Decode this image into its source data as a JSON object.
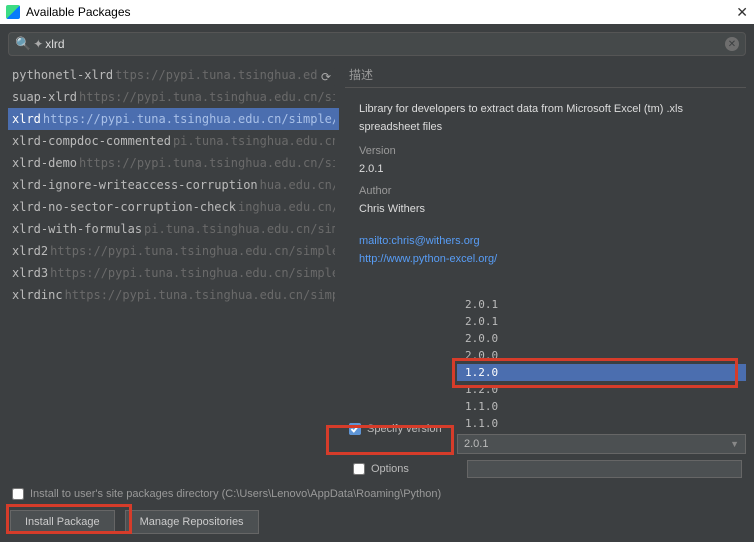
{
  "window": {
    "title": "Available Packages"
  },
  "search": {
    "value": "xlrd"
  },
  "packages": [
    {
      "name": "pythonetl-xlrd",
      "url": "ttps://pypi.tuna.tsinghua.edu.cn/simple/",
      "selected": false
    },
    {
      "name": "suap-xlrd",
      "url": "https://pypi.tuna.tsinghua.edu.cn/simple/",
      "selected": false
    },
    {
      "name": "xlrd",
      "url": "https://pypi.tuna.tsinghua.edu.cn/simple/",
      "selected": true
    },
    {
      "name": "xlrd-compdoc-commented",
      "url": "pi.tuna.tsinghua.edu.cn/simple/",
      "selected": false
    },
    {
      "name": "xlrd-demo",
      "url": "https://pypi.tuna.tsinghua.edu.cn/simple/",
      "selected": false
    },
    {
      "name": "xlrd-ignore-writeaccess-corruption",
      "url": "hua.edu.cn/simple/",
      "selected": false
    },
    {
      "name": "xlrd-no-sector-corruption-check",
      "url": "inghua.edu.cn/simple/",
      "selected": false
    },
    {
      "name": "xlrd-with-formulas",
      "url": "pi.tuna.tsinghua.edu.cn/simple/",
      "selected": false
    },
    {
      "name": "xlrd2",
      "url": "https://pypi.tuna.tsinghua.edu.cn/simple/",
      "selected": false
    },
    {
      "name": "xlrd3",
      "url": "https://pypi.tuna.tsinghua.edu.cn/simple/",
      "selected": false
    },
    {
      "name": "xlrdinc",
      "url": "https://pypi.tuna.tsinghua.edu.cn/simple/",
      "selected": false
    }
  ],
  "detail": {
    "header": "描述",
    "summary": "Library for developers to extract data from Microsoft Excel (tm) .xls spreadsheet files",
    "version_label": "Version",
    "version_value": "2.0.1",
    "author_label": "Author",
    "author_value": "Chris Withers",
    "links": [
      "mailto:chris@withers.org",
      "http://www.python-excel.org/"
    ]
  },
  "version_panel": {
    "specify_label": "Specify version",
    "specify_checked": true,
    "options_label": "Options",
    "options_checked": false,
    "selected_version": "2.0.1",
    "list": [
      {
        "v": "2.0.1",
        "sel": false
      },
      {
        "v": "2.0.1",
        "sel": false
      },
      {
        "v": "2.0.0",
        "sel": false
      },
      {
        "v": "2.0.0",
        "sel": false
      },
      {
        "v": "1.2.0",
        "sel": true
      },
      {
        "v": "1.2.0",
        "sel": false
      },
      {
        "v": "1.1.0",
        "sel": false
      },
      {
        "v": "1.1.0",
        "sel": false
      }
    ]
  },
  "footer": {
    "install_user_label": "Install to user's site packages directory (C:\\Users\\Lenovo\\AppData\\Roaming\\Python)",
    "install_button": "Install Package",
    "manage_button": "Manage Repositories"
  }
}
